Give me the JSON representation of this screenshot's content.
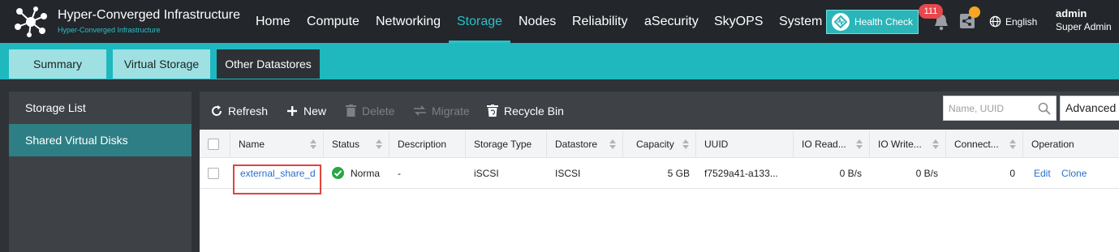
{
  "brand": {
    "title": "Hyper-Converged Infrastructure",
    "subtitle": "Hyper-Converged Infrastructure"
  },
  "nav": {
    "items": [
      "Home",
      "Compute",
      "Networking",
      "Storage",
      "Nodes",
      "Reliability",
      "aSecurity",
      "SkyOPS",
      "System"
    ],
    "active": "Storage",
    "health_check": "Health Check",
    "alert_count": "111",
    "language": "English",
    "user": {
      "name": "admin",
      "role": "Super Admin"
    }
  },
  "subtabs": {
    "items": [
      "Summary",
      "Virtual Storage",
      "Other Datastores"
    ],
    "active": "Other Datastores"
  },
  "sidebar": {
    "items": [
      "Storage List",
      "Shared Virtual Disks"
    ],
    "active": "Shared Virtual Disks"
  },
  "toolbar": {
    "refresh": "Refresh",
    "new": "New",
    "delete": "Delete",
    "migrate": "Migrate",
    "recycle_bin": "Recycle Bin",
    "search_placeholder": "Name, UUID",
    "advanced": "Advanced"
  },
  "table": {
    "columns": [
      "Name",
      "Status",
      "Description",
      "Storage Type",
      "Datastore",
      "Capacity",
      "UUID",
      "IO Read...",
      "IO Write...",
      "Connect...",
      "Operation"
    ],
    "rows": [
      {
        "name": "external_share_d",
        "status": "Norma",
        "description": "-",
        "storage_type": "iSCSI",
        "datastore": "ISCSI",
        "capacity": "5 GB",
        "uuid": "f7529a41-a133...",
        "io_read": "0 B/s",
        "io_write": "0 B/s",
        "connections": "0",
        "op_edit": "Edit",
        "op_clone": "Clone"
      }
    ]
  },
  "colors": {
    "accent": "#29c2c8",
    "topbar": "#23262b",
    "subbar": "#1fb8bf",
    "link": "#2a6fc9",
    "highlight": "#e0443e",
    "status_ok": "#25a744"
  }
}
